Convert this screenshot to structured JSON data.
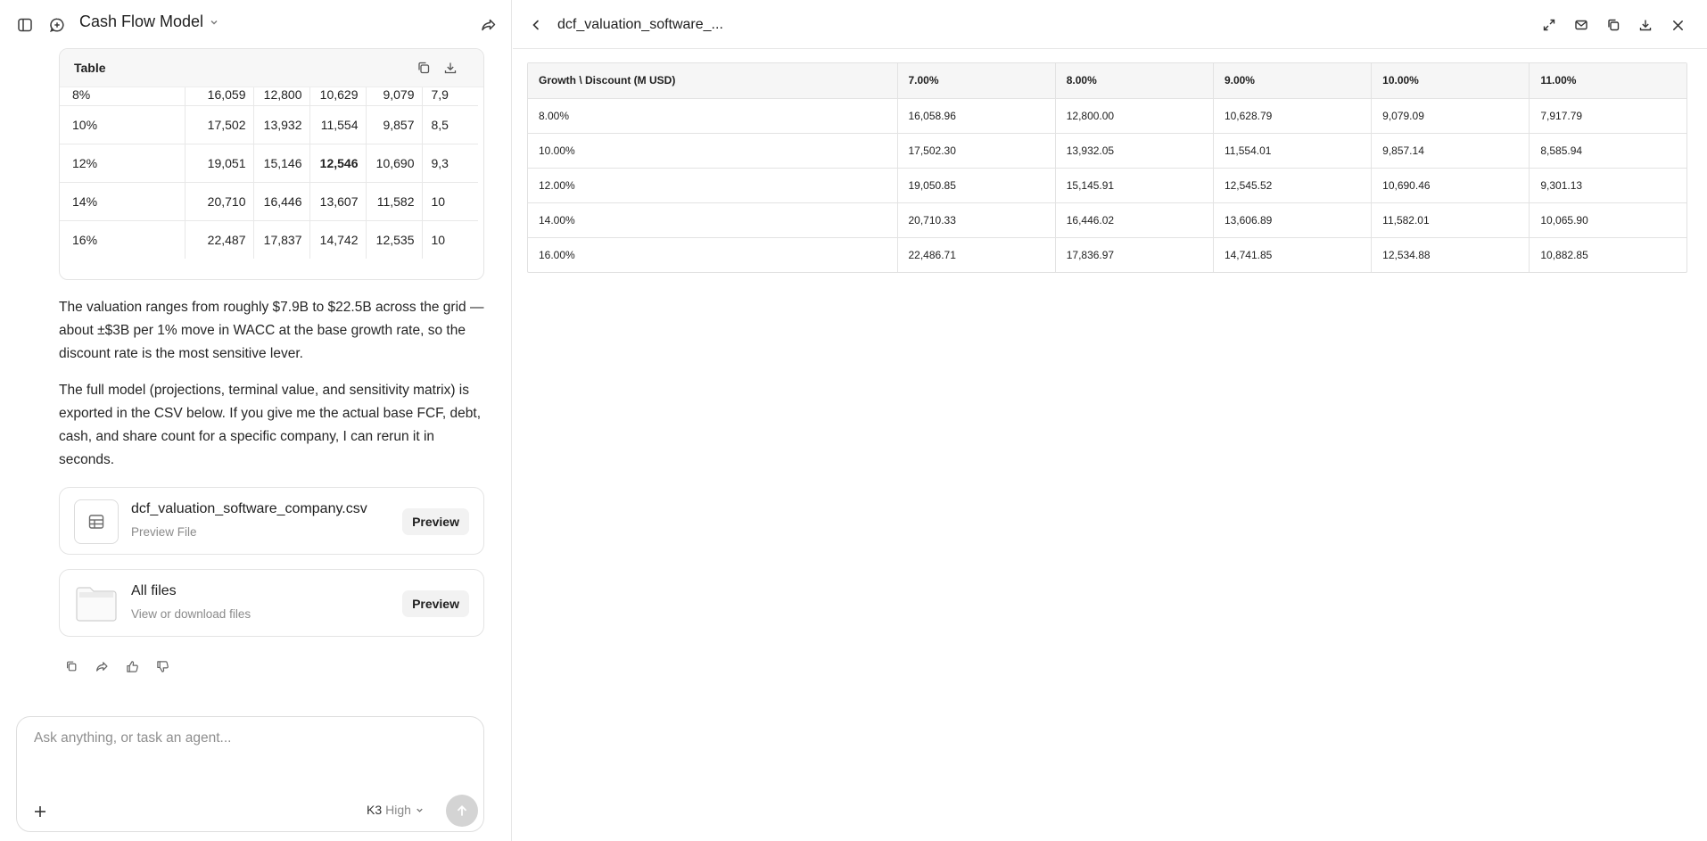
{
  "chat": {
    "title": "Cash Flow Model",
    "table_card": {
      "title": "Table",
      "rows": [
        [
          "8%",
          "16,059",
          "12,800",
          "10,629",
          "9,079",
          "7,9"
        ],
        [
          "10%",
          "17,502",
          "13,932",
          "11,554",
          "9,857",
          "8,5"
        ],
        [
          "12%",
          "19,051",
          "15,146",
          "12,546",
          "10,690",
          "9,3"
        ],
        [
          "14%",
          "20,710",
          "16,446",
          "13,607",
          "11,582",
          "10"
        ],
        [
          "16%",
          "22,487",
          "17,837",
          "14,742",
          "12,535",
          "10"
        ]
      ]
    },
    "paragraphs": [
      "The valuation ranges from roughly $7.9B to $22.5B across the grid — about ±$3B per 1% move in WACC at the base growth rate, so the discount rate is the most sensitive lever.",
      "The full model (projections, terminal value, and sensitivity matrix) is exported in the CSV below. If you give me the actual base FCF, debt, cash, and share count for a specific company, I can rerun it in seconds."
    ],
    "files": [
      {
        "name": "dcf_valuation_software_company.csv",
        "subtitle": "Preview File",
        "button": "Preview"
      },
      {
        "name": "All files",
        "subtitle": "View or download files",
        "button": "Preview"
      }
    ],
    "input": {
      "placeholder": "Ask anything, or task an agent...",
      "model": "K3",
      "effort": "High"
    }
  },
  "preview": {
    "title": "dcf_valuation_software_...",
    "columns": [
      "Growth \\ Discount (M USD)",
      "7.00%",
      "8.00%",
      "9.00%",
      "10.00%",
      "11.00%"
    ],
    "rows": [
      [
        "8.00%",
        "16,058.96",
        "12,800.00",
        "10,628.79",
        "9,079.09",
        "7,917.79"
      ],
      [
        "10.00%",
        "17,502.30",
        "13,932.05",
        "11,554.01",
        "9,857.14",
        "8,585.94"
      ],
      [
        "12.00%",
        "19,050.85",
        "15,145.91",
        "12,545.52",
        "10,690.46",
        "9,301.13"
      ],
      [
        "14.00%",
        "20,710.33",
        "16,446.02",
        "13,606.89",
        "11,582.01",
        "10,065.90"
      ],
      [
        "16.00%",
        "22,486.71",
        "17,836.97",
        "14,741.85",
        "12,534.88",
        "10,882.85"
      ]
    ]
  }
}
